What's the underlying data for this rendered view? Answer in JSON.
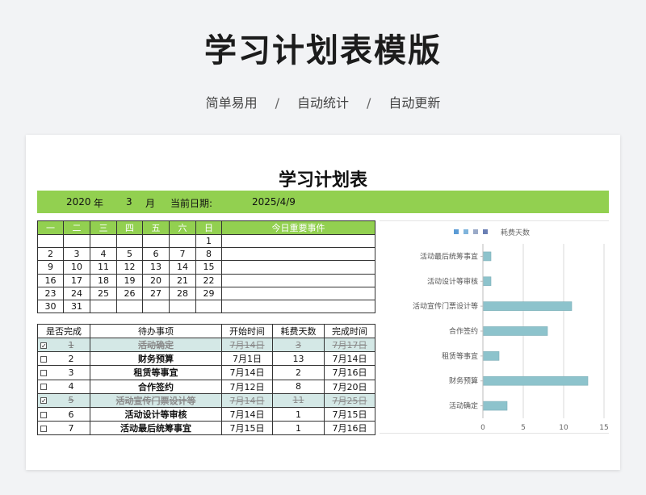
{
  "header": {
    "title": "学习计划表模版",
    "features": [
      "简单易用",
      "自动统计",
      "自动更新"
    ],
    "separator": "/"
  },
  "sheet": {
    "title": "学习计划表",
    "info": {
      "year": "2020",
      "year_unit": "年",
      "month": "3",
      "month_unit": "月",
      "date_label": "当前日期:",
      "date_value": "2025/4/9"
    },
    "calendar": {
      "weekdays": [
        "一",
        "二",
        "三",
        "四",
        "五",
        "六",
        "日"
      ],
      "events_header": "今日重要事件",
      "weeks": [
        [
          "",
          "",
          "",
          "",
          "",
          "",
          "1"
        ],
        [
          "2",
          "3",
          "4",
          "5",
          "6",
          "7",
          "8"
        ],
        [
          "9",
          "10",
          "11",
          "12",
          "13",
          "14",
          "15"
        ],
        [
          "16",
          "17",
          "18",
          "19",
          "20",
          "21",
          "22"
        ],
        [
          "23",
          "24",
          "25",
          "26",
          "27",
          "28",
          "29"
        ],
        [
          "30",
          "31",
          "",
          "",
          "",
          "",
          ""
        ]
      ]
    },
    "todo": {
      "headers": [
        "是否完成",
        "待办事项",
        "开始时间",
        "耗费天数",
        "完成时间"
      ],
      "rows": [
        {
          "checked": true,
          "no": "1",
          "task": "活动确定",
          "start": "7月14日",
          "days": "3",
          "end": "7月17日"
        },
        {
          "checked": false,
          "no": "2",
          "task": "财务预算",
          "start": "7月1日",
          "days": "13",
          "end": "7月14日"
        },
        {
          "checked": false,
          "no": "3",
          "task": "租赁等事宜",
          "start": "7月14日",
          "days": "2",
          "end": "7月16日"
        },
        {
          "checked": false,
          "no": "4",
          "task": "合作签约",
          "start": "7月12日",
          "days": "8",
          "end": "7月20日"
        },
        {
          "checked": true,
          "no": "5",
          "task": "活动宣传门票设计等",
          "start": "7月14日",
          "days": "11",
          "end": "7月25日"
        },
        {
          "checked": false,
          "no": "6",
          "task": "活动设计等审核",
          "start": "7月14日",
          "days": "1",
          "end": "7月15日"
        },
        {
          "checked": false,
          "no": "7",
          "task": "活动最后统筹事宜",
          "start": "7月15日",
          "days": "1",
          "end": "7月16日"
        }
      ]
    }
  },
  "chart_data": {
    "type": "bar",
    "orientation": "horizontal",
    "categories": [
      "活动确定",
      "财务预算",
      "租赁等事宜",
      "合作签约",
      "活动宣传门票设计等",
      "活动设计等审核",
      "活动最后统筹事宜"
    ],
    "series": [
      {
        "name": "耗费天数",
        "values": [
          3,
          13,
          2,
          8,
          11,
          1,
          1
        ]
      }
    ],
    "xlim": [
      0,
      15
    ],
    "xticks": [
      "0",
      "5",
      "10",
      "15"
    ],
    "grid": true,
    "legend": "top",
    "bar_color": "#8dc3cc",
    "legend_colors": [
      "#5b9bd5",
      "#7fb4dc",
      "#9aaac8",
      "#6a7fb4"
    ]
  }
}
